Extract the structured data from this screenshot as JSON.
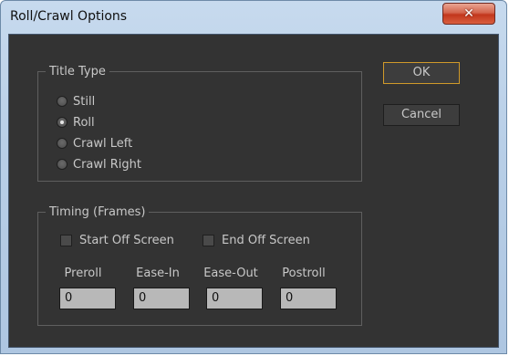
{
  "window": {
    "title": "Roll/Crawl Options",
    "close_glyph": "✕"
  },
  "title_type": {
    "legend": "Title Type",
    "options": [
      {
        "label": "Still",
        "checked": false
      },
      {
        "label": "Roll",
        "checked": true
      },
      {
        "label": "Crawl Left",
        "checked": false
      },
      {
        "label": "Crawl Right",
        "checked": false
      }
    ]
  },
  "timing": {
    "legend": "Timing (Frames)",
    "start_off_screen": {
      "label": "Start Off Screen",
      "checked": false
    },
    "end_off_screen": {
      "label": "End Off Screen",
      "checked": false
    },
    "fields": [
      {
        "label": "Preroll",
        "value": "0"
      },
      {
        "label": "Ease-In",
        "value": "0"
      },
      {
        "label": "Ease-Out",
        "value": "0"
      },
      {
        "label": "Postroll",
        "value": "0"
      }
    ]
  },
  "buttons": {
    "ok": "OK",
    "cancel": "Cancel"
  },
  "colors": {
    "panel": "#333333",
    "text": "#c8c8c8",
    "default_button_border": "#d09a2a",
    "input_bg": "#b8b8b8"
  }
}
